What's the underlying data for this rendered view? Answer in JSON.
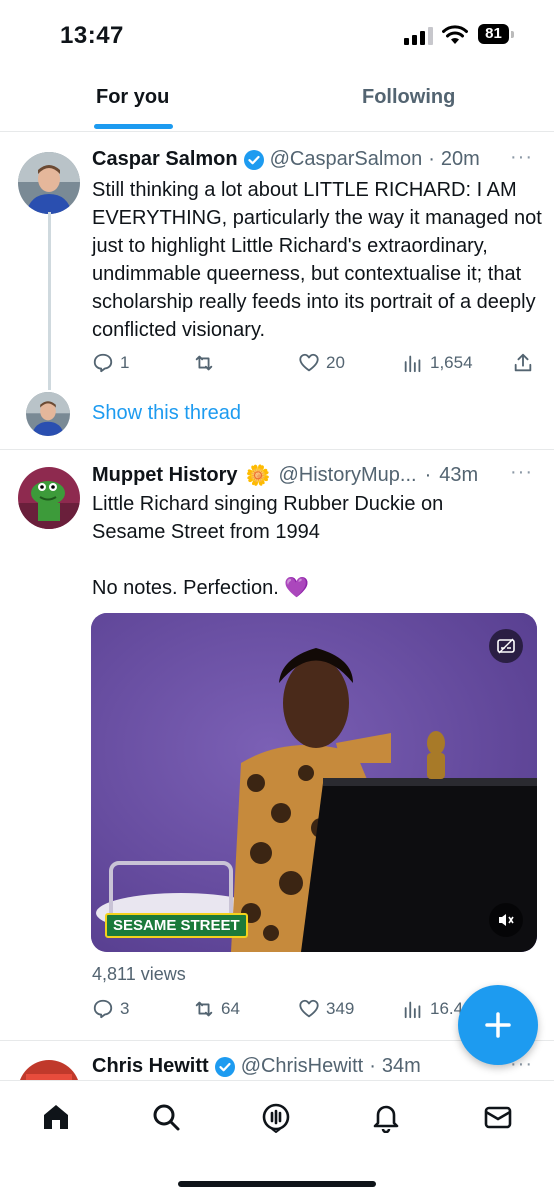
{
  "status_bar": {
    "time": "13:47",
    "battery": "81"
  },
  "tabs": [
    {
      "label": "For you",
      "active": true
    },
    {
      "label": "Following",
      "active": false
    }
  ],
  "tweets": [
    {
      "name": "Caspar Salmon",
      "verified": true,
      "handle": "@CasparSalmon",
      "time": "20m",
      "text": "Still thinking a lot about LITTLE RICHARD: I AM EVERYTHING, particularly the way it managed not just to highlight Little Richard's extraordinary, undimmable queerness, but contextualise it; that scholarship really feeds into its portrait of a deeply conflicted visionary.",
      "replies": "1",
      "retweets": "",
      "likes": "20",
      "views": "1,654",
      "show_thread": "Show this thread"
    },
    {
      "name": "Muppet History",
      "emoji": "🌼",
      "handle": "@HistoryMup...",
      "time": "43m",
      "text": "Little Richard singing Rubber Duckie on\nSesame Street from 1994\n\nNo notes. Perfection. 💜",
      "video_logo": "SESAME STREET",
      "video_views": "4,811 views",
      "replies": "3",
      "retweets": "64",
      "likes": "349",
      "views": "16.4"
    },
    {
      "name": "Chris Hewitt",
      "verified": true,
      "handle": "@ChrisHewitt",
      "time": "34m"
    }
  ],
  "colors": {
    "accent": "#1d9bf0",
    "text": "#0f1419",
    "secondary": "#536471",
    "heart": "#8b4fd6"
  },
  "icons": [
    "home-icon",
    "search-icon",
    "spaces-icon",
    "notifications-icon",
    "messages-icon",
    "compose-plus-icon"
  ]
}
